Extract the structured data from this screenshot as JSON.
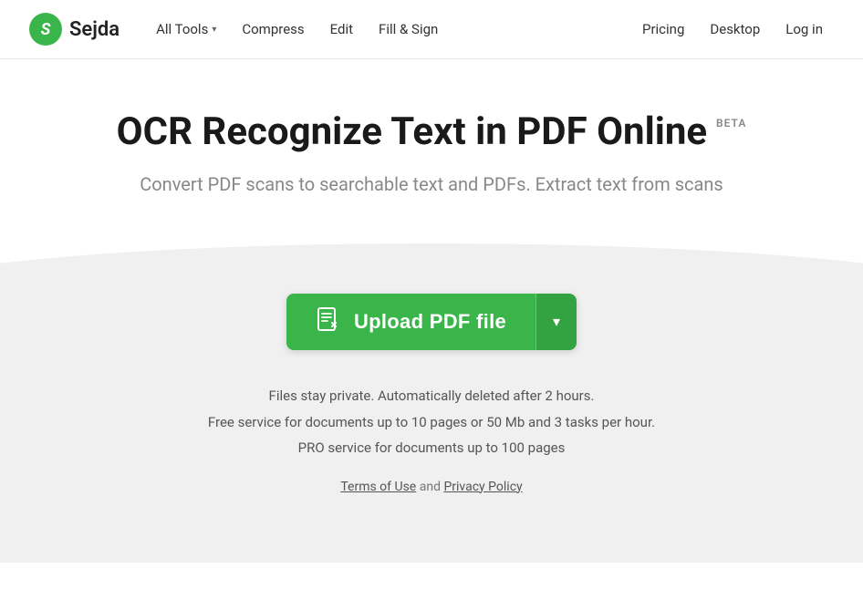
{
  "navbar": {
    "logo_letter": "S",
    "logo_name": "Sejda",
    "nav_items": [
      {
        "label": "All Tools",
        "has_dropdown": true
      },
      {
        "label": "Compress",
        "has_dropdown": false
      },
      {
        "label": "Edit",
        "has_dropdown": false
      },
      {
        "label": "Fill & Sign",
        "has_dropdown": false
      }
    ],
    "nav_right": [
      {
        "label": "Pricing"
      },
      {
        "label": "Desktop"
      },
      {
        "label": "Log in"
      }
    ]
  },
  "hero": {
    "title": "OCR Recognize Text in PDF Online",
    "beta_label": "BETA",
    "subtitle": "Convert PDF scans to searchable text and PDFs. Extract text from scans"
  },
  "upload": {
    "button_label": "Upload PDF file",
    "dropdown_arrow": "▼"
  },
  "info": {
    "line1": "Files stay private. Automatically deleted after 2 hours.",
    "line2": "Free service for documents up to 10 pages or 50 Mb and 3 tasks per hour.",
    "line3": "PRO service for documents up to 100 pages"
  },
  "terms": {
    "prefix": "",
    "terms_label": "Terms of Use",
    "and": "and",
    "privacy_label": "Privacy Policy"
  }
}
